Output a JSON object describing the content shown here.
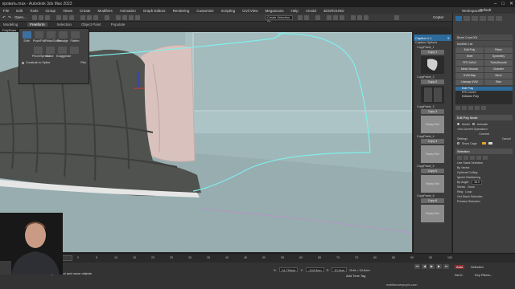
{
  "window": {
    "title": "кровать.max - Autodesk 3ds Max 2023",
    "workspace_label": "Workspaces:",
    "workspace_value": "Default",
    "user": "Cepter"
  },
  "menu": [
    "File",
    "Edit",
    "Tools",
    "Group",
    "Views",
    "Create",
    "Modifiers",
    "Animation",
    "Graph Editors",
    "Rendering",
    "Customize",
    "Scripting",
    "Civil View",
    "Megascans",
    "Help",
    "Arnold",
    "3DGROUND"
  ],
  "toolbar": {
    "selection_set": "Create Selection Se",
    "view_dropdown": "Open..."
  },
  "ribbon": {
    "tabs": [
      "Modeling",
      "Freeform",
      "Selection",
      "Object Paint",
      "Populate"
    ],
    "active_tab": "Freeform"
  },
  "subtabs": {
    "items": [
      "PolyDraw",
      "Paint Deform",
      "Defaults"
    ],
    "active": "Paint Deform"
  },
  "paint_deform_popup": {
    "tools": [
      "Shift",
      "Push/Pull",
      "Relax/Soften",
      "Smudge",
      "Flatten",
      "Pinch/Spread",
      "Noise",
      "Exaggerate"
    ],
    "extra_label": "Pick",
    "constrain_label": "Constrain to Spline"
  },
  "caption_panel": {
    "title": "Caption 1.1",
    "subtitle": "Caption Options",
    "slots": [
      {
        "label": "CopyPaste_1",
        "button": "Copy 1",
        "state": "image"
      },
      {
        "label": "CopyPaste_2",
        "button": "Copy 2",
        "state": "image"
      },
      {
        "label": "CopyPaste_3",
        "button": "Copy 3",
        "state": "empty"
      },
      {
        "label": "CopyPaste_4",
        "button": "Copy 4",
        "state": "empty"
      },
      {
        "label": "CopyPaste_5",
        "button": "Copy 5",
        "state": "empty"
      },
      {
        "label": "CopyPaste_6",
        "button": "Copy 6",
        "state": "empty"
      }
    ],
    "empty_text": "Empty Slot"
  },
  "command_panel": {
    "object_name": "Bezel Cover001",
    "modifier_list": "Modifier List",
    "buttons": [
      "Edit Poly",
      "Relax",
      "Shell",
      "Symmetry",
      "FFD 2x2x2",
      "TurboSmooth",
      "Mesh Smooth",
      "Chamfer",
      "UVW Map",
      "Bend",
      "Unwrap UVW",
      "Slice"
    ],
    "stack": [
      "Edit Poly",
      "FFD 2x2x2",
      "Editable Poly"
    ],
    "stack_selected": "Edit Poly",
    "rollout_mode": "Edit Poly Mode",
    "mode_model": "Model",
    "mode_animate": "Animate",
    "no_op": "<No Current Operation>",
    "commit": "Commit",
    "settings": "Settings",
    "cancel": "Cancel",
    "show_cage": "Show Cage",
    "rollout_selection": "Selection",
    "use_stack": "Use Stack Selection",
    "by_vertex": "By Vertex",
    "ignore_backfacing": "Ignore Backfacing",
    "by_angle": "By Angle:",
    "angle_value": "45.0",
    "shrink": "Shrink",
    "grow": "Grow",
    "ring": "Ring",
    "loop": "Loop",
    "get_stack": "Get Stack Selection",
    "preview": "Preview Selection",
    "optional_culling": "Optional Culling"
  },
  "timeline": {
    "ticks": [
      "0",
      "5",
      "10",
      "15",
      "20",
      "25",
      "30",
      "35",
      "40",
      "45",
      "50",
      "55",
      "60",
      "65",
      "70",
      "75",
      "80",
      "85",
      "90",
      "95",
      "100"
    ]
  },
  "status": {
    "maxscript": "\"false\"",
    "hint": "Click and drag to select and move objects",
    "x_label": "X:",
    "x_value": "14,794cm",
    "y_label": "Y:",
    "y_value": "-144,3cm",
    "z_label": "Z:",
    "z_value": "10,0cm",
    "grid_label": "Grid = 10,0cm",
    "add_time_tag": "Add Time Tag",
    "auto_key": "Auto",
    "selected": "Selected",
    "set_key": "Set K.",
    "key_filters": "Key Filters...",
    "watermark": "mattheuserpupin.com"
  },
  "colors": {
    "viewport_bg": "#9fb7b9",
    "headboard": "#a7c0c2",
    "blanket": "#4f524f",
    "pillow": "#d9c2be",
    "spline": "#7ff0ec",
    "selection_blue": "#2d6b9a"
  }
}
